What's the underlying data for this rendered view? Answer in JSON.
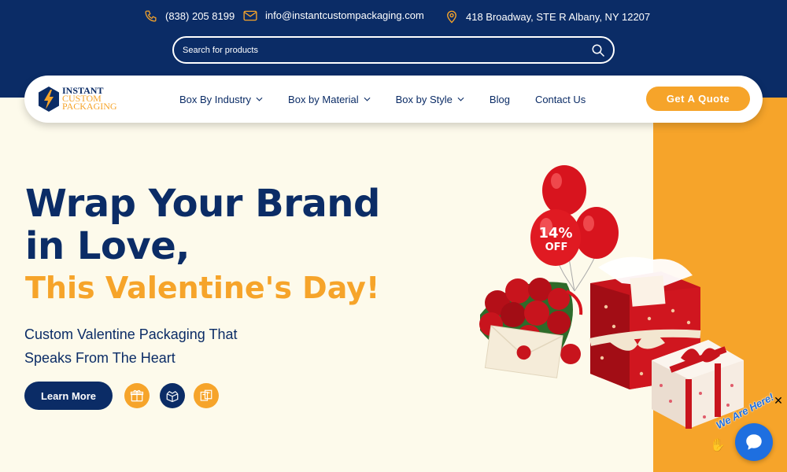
{
  "contact": {
    "phone": "(838) 205 8199",
    "email": "info@instantcustompackaging.com",
    "address": "418 Broadway, STE R Albany, NY 12207"
  },
  "search": {
    "placeholder": "Search for products"
  },
  "logo": {
    "line1": "INSTANT",
    "line2": "CUSTOM",
    "line3": "PACKAGING"
  },
  "nav": {
    "items": [
      {
        "label": "Box By Industry",
        "has_dropdown": true
      },
      {
        "label": "Box by Material",
        "has_dropdown": true
      },
      {
        "label": "Box by Style",
        "has_dropdown": true
      },
      {
        "label": "Blog",
        "has_dropdown": false
      },
      {
        "label": "Contact Us",
        "has_dropdown": false
      }
    ],
    "quote_label": "Get A Quote"
  },
  "hero": {
    "title_line1": "Wrap Your Brand",
    "title_line2": "in Love,",
    "title_accent": "This Valentine's Day!",
    "subtitle_line1": "Custom Valentine Packaging That",
    "subtitle_line2": "Speaks From The Heart",
    "cta_label": "Learn More",
    "balloon_text_1": "14%",
    "balloon_text_2": "OFF"
  },
  "chat": {
    "tagline": "We Are Here!",
    "close_glyph": "✕"
  },
  "colors": {
    "navy": "#0b2c66",
    "orange": "#f6a42a",
    "cream": "#fdfaeb",
    "chat_blue": "#1e6fe0"
  }
}
